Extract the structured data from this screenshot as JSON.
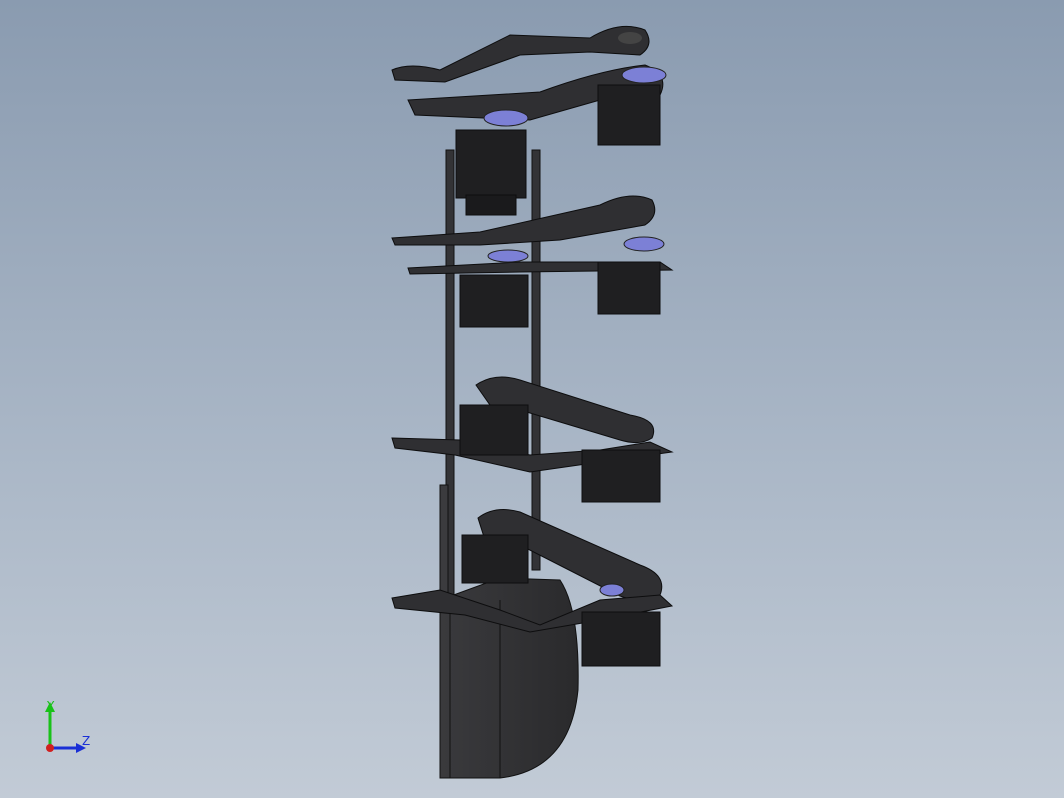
{
  "viewport": {
    "model": "robot-leg-servo-assembly",
    "colors": {
      "background_top": "#8a9bb0",
      "background_bottom": "#c2cbd6",
      "part_fill": "#2e2e31",
      "part_edge": "#0d0d0e",
      "servo_fill": "#1f1f21",
      "bearing": "#7c80d6"
    }
  },
  "triad": {
    "y_label": "Y",
    "z_label": "Z",
    "y_color": "#19c219",
    "z_color": "#1a2fd6",
    "origin_color": "#d11f1f"
  }
}
